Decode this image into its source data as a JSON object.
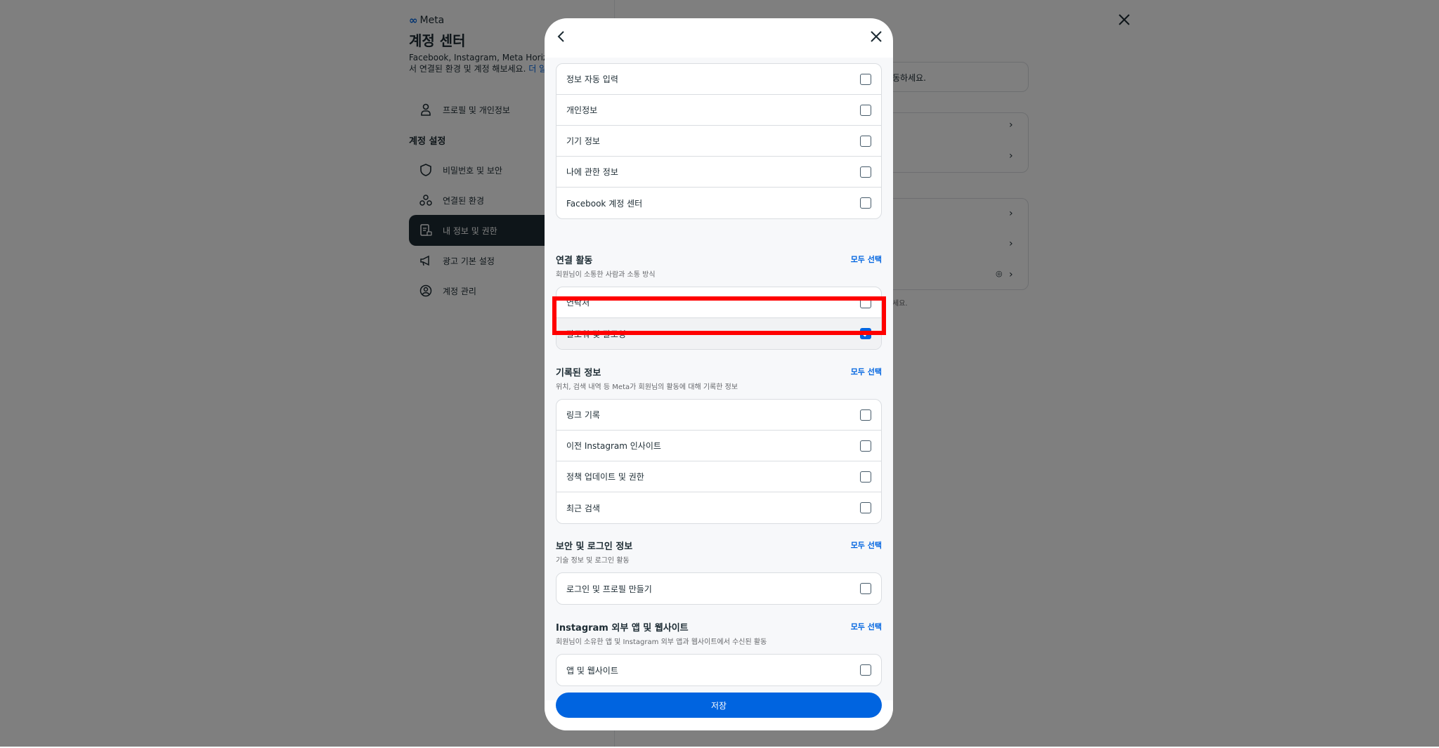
{
  "background": {
    "brand": "Meta",
    "title": "계정 센터",
    "description": "Facebook, Instagram, Meta Horiz 테크놀로지 전반에서 연결된 환경 및 계정 해보세요.",
    "description_link": "더 알아보기",
    "nav_profile": "프로필 및 개인정보",
    "section_label": "계정 설정",
    "nav_items": [
      {
        "label": "비밀번호 및 보안"
      },
      {
        "label": "연결된 환경"
      },
      {
        "label": "내 정보 및 권한"
      },
      {
        "label": "광고 기본 설정"
      },
      {
        "label": "계정 관리"
      }
    ],
    "right_text_1": "동하세요.",
    "right_text_2": "세요."
  },
  "modal": {
    "top_group": [
      {
        "label": "정보 자동 입력",
        "checked": false
      },
      {
        "label": "개인정보",
        "checked": false
      },
      {
        "label": "기기 정보",
        "checked": false
      },
      {
        "label": "나에 관한 정보",
        "checked": false
      },
      {
        "label": "Facebook 계정 센터",
        "checked": false
      }
    ],
    "sections": [
      {
        "title": "연결 활동",
        "subtitle": "회원님이 소통한 사람과 소통 방식",
        "select_all": "모두 선택",
        "items": [
          {
            "label": "연락처",
            "checked": false
          },
          {
            "label": "팔로워 및 팔로잉",
            "checked": true
          }
        ]
      },
      {
        "title": "기록된 정보",
        "subtitle": "위치, 검색 내역 등 Meta가 회원님의 활동에 대해 기록한 정보",
        "select_all": "모두 선택",
        "items": [
          {
            "label": "링크 기록",
            "checked": false
          },
          {
            "label": "이전 Instagram 인사이트",
            "checked": false
          },
          {
            "label": "정책 업데이트 및 권한",
            "checked": false
          },
          {
            "label": "최근 검색",
            "checked": false
          }
        ]
      },
      {
        "title": "보안 및 로그인 정보",
        "subtitle": "기술 정보 및 로그인 활동",
        "select_all": "모두 선택",
        "items": [
          {
            "label": "로그인 및 프로필 만들기",
            "checked": false
          }
        ]
      },
      {
        "title": "Instagram 외부 앱 및 웹사이트",
        "subtitle": "회원님이 소유한 앱 및 Instagram 외부 앱과 웹사이트에서 수신된 활동",
        "select_all": "모두 선택",
        "items": [
          {
            "label": "앱 및 웹사이트",
            "checked": false
          }
        ]
      }
    ],
    "save_label": "저장"
  },
  "colors": {
    "accent": "#0064e0",
    "highlight": "#ff0000",
    "overlay": "rgba(0,0,0,0.5)"
  }
}
